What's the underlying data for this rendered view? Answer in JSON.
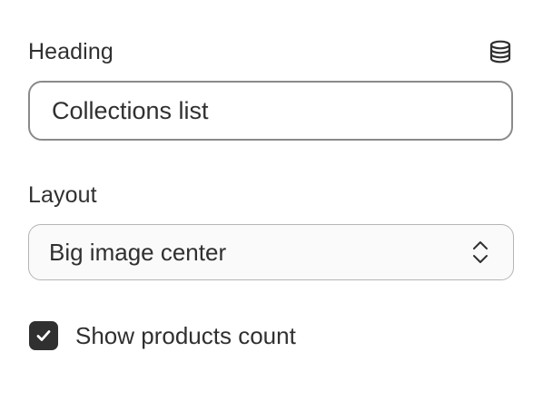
{
  "heading_field": {
    "label": "Heading",
    "value": "Collections list",
    "icon": "database-icon"
  },
  "layout_field": {
    "label": "Layout",
    "selected": "Big image center",
    "icon": "chevron-up-down-icon"
  },
  "show_count": {
    "label": "Show products count",
    "checked": true,
    "icon": "checkmark-icon"
  },
  "colors": {
    "text": "#303030",
    "checkbox_fill": "#303030",
    "field_border": "#8a8a8a",
    "select_background": "#fafafa"
  }
}
